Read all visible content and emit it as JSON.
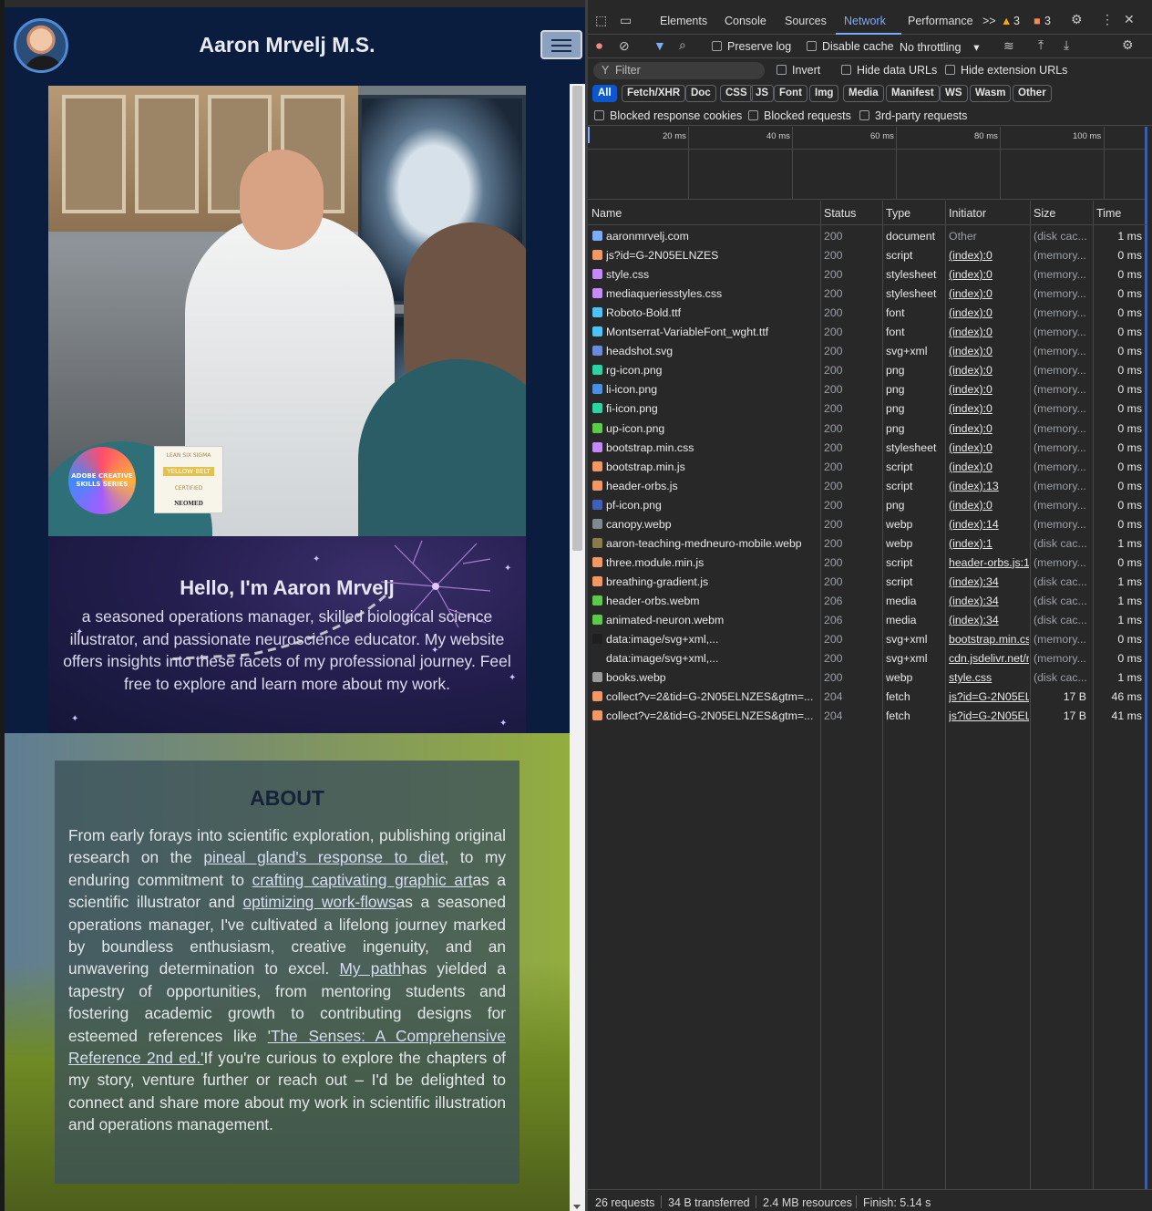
{
  "site": {
    "name": "Aaron Mrvelj M.S.",
    "badges": {
      "adobe": "ADOBE CREATIVE SKILLS SERIES",
      "yellow_belt_top": "LEAN SIX SIGMA",
      "yellow_belt": "YELLOW BELT",
      "yellow_belt_cert": "CERTIFIED",
      "neomed": "NEOMED"
    },
    "intro": {
      "title": "Hello, I'm Aaron Mrvelj",
      "body": "a seasoned operations manager, skilled biological science illustrator, and passionate neuroscience educator. My website offers insights into these facets of my professional journey. Feel free to explore and learn more about my work."
    },
    "about": {
      "title": "ABOUT",
      "p1": "From early forays into scientific exploration, publishing original research on the ",
      "link1": "pineal gland's response to diet",
      "p2": ", to my enduring commitment to ",
      "link2": "crafting captivating graphic art",
      "p3": "as a scientific illustrator and ",
      "link3": "optimizing work-flows",
      "p4": "as a seasoned operations manager, I've cultivated a lifelong journey marked by boundless enthusiasm, creative ingenuity, and an unwavering determination to excel. ",
      "link4": "My path",
      "p5": "has yielded a tapestry of opportunities, from mentoring students and fostering academic growth to contributing designs for esteemed references like ",
      "link5": "'The Senses: A Comprehensive Reference 2nd ed.'",
      "p6": "If you're curious to explore the chapters of my story, venture further or reach out – I'd be delighted to connect and share more about my work in scientific illustration and operations management."
    }
  },
  "devtools": {
    "tabs": [
      "Elements",
      "Console",
      "Sources",
      "Network",
      "Performance"
    ],
    "active_tab": "Network",
    "more_tabs": ">>",
    "warnings": "3",
    "errors": "3",
    "toolbar": {
      "preserve_log": "Preserve log",
      "disable_cache": "Disable cache",
      "throttling": "No throttling"
    },
    "filter": {
      "placeholder": "Filter",
      "invert": "Invert",
      "hide_data_urls": "Hide data URLs",
      "hide_ext_urls": "Hide extension URLs"
    },
    "type_filters": [
      "All",
      "Fetch/XHR",
      "Doc",
      "CSS",
      "JS",
      "Font",
      "Img",
      "Media",
      "Manifest",
      "WS",
      "Wasm",
      "Other"
    ],
    "options": {
      "blocked_cookies": "Blocked response cookies",
      "blocked_requests": "Blocked requests",
      "third_party": "3rd-party requests"
    },
    "timeline_labels": [
      "20 ms",
      "40 ms",
      "60 ms",
      "80 ms",
      "100 ms"
    ],
    "columns": [
      "Name",
      "Status",
      "Type",
      "Initiator",
      "Size",
      "Time"
    ],
    "requests": [
      {
        "name": "aaronmrvelj.com",
        "status": "200",
        "type": "document",
        "initiator": "Other",
        "size": "(disk cac...",
        "time": "1 ms",
        "icon": "doc-icon",
        "color": "#7cacf8"
      },
      {
        "name": "js?id=G-2N05ELNZES",
        "status": "200",
        "type": "script",
        "initiator": "(index):0",
        "size": "(memory...",
        "time": "0 ms",
        "icon": "script-icon",
        "color": "#f29766"
      },
      {
        "name": "style.css",
        "status": "200",
        "type": "stylesheet",
        "initiator": "(index):0",
        "size": "(memory...",
        "time": "0 ms",
        "icon": "css-icon",
        "color": "#c58af9"
      },
      {
        "name": "mediaqueriesstyles.css",
        "status": "200",
        "type": "stylesheet",
        "initiator": "(index):0",
        "size": "(memory...",
        "time": "0 ms",
        "icon": "css-icon",
        "color": "#c58af9"
      },
      {
        "name": "Roboto-Bold.ttf",
        "status": "200",
        "type": "font",
        "initiator": "(index):0",
        "size": "(memory...",
        "time": "0 ms",
        "icon": "font-icon",
        "color": "#4fc3f7"
      },
      {
        "name": "Montserrat-VariableFont_wght.ttf",
        "status": "200",
        "type": "font",
        "initiator": "(index):0",
        "size": "(memory...",
        "time": "0 ms",
        "icon": "font-icon",
        "color": "#4fc3f7"
      },
      {
        "name": "headshot.svg",
        "status": "200",
        "type": "svg+xml",
        "initiator": "(index):0",
        "size": "(memory...",
        "time": "0 ms",
        "icon": "image-icon",
        "color": "#6a8bd8"
      },
      {
        "name": "rg-icon.png",
        "status": "200",
        "type": "png",
        "initiator": "(index):0",
        "size": "(memory...",
        "time": "0 ms",
        "icon": "png-icon",
        "color": "#2bd4a2"
      },
      {
        "name": "li-icon.png",
        "status": "200",
        "type": "png",
        "initiator": "(index):0",
        "size": "(memory...",
        "time": "0 ms",
        "icon": "png-icon",
        "color": "#4a90e2"
      },
      {
        "name": "fi-icon.png",
        "status": "200",
        "type": "png",
        "initiator": "(index):0",
        "size": "(memory...",
        "time": "0 ms",
        "icon": "png-icon",
        "color": "#2bd4a2"
      },
      {
        "name": "up-icon.png",
        "status": "200",
        "type": "png",
        "initiator": "(index):0",
        "size": "(memory...",
        "time": "0 ms",
        "icon": "png-icon",
        "color": "#5cc94a"
      },
      {
        "name": "bootstrap.min.css",
        "status": "200",
        "type": "stylesheet",
        "initiator": "(index):0",
        "size": "(memory...",
        "time": "0 ms",
        "icon": "css-icon",
        "color": "#c58af9"
      },
      {
        "name": "bootstrap.min.js",
        "status": "200",
        "type": "script",
        "initiator": "(index):0",
        "size": "(memory...",
        "time": "0 ms",
        "icon": "script-icon",
        "color": "#f29766"
      },
      {
        "name": "header-orbs.js",
        "status": "200",
        "type": "script",
        "initiator": "(index):13",
        "size": "(memory...",
        "time": "0 ms",
        "icon": "script-icon",
        "color": "#f29766"
      },
      {
        "name": "pf-icon.png",
        "status": "200",
        "type": "png",
        "initiator": "(index):0",
        "size": "(memory...",
        "time": "0 ms",
        "icon": "png-icon",
        "color": "#3f5fb8"
      },
      {
        "name": "canopy.webp",
        "status": "200",
        "type": "webp",
        "initiator": "(index):14",
        "size": "(memory...",
        "time": "0 ms",
        "icon": "webp-icon",
        "color": "#7d8a8f"
      },
      {
        "name": "aaron-teaching-medneuro-mobile.webp",
        "status": "200",
        "type": "webp",
        "initiator": "(index):1",
        "size": "(disk cac...",
        "time": "1 ms",
        "icon": "webp-icon",
        "color": "#8a7a4f"
      },
      {
        "name": "three.module.min.js",
        "status": "200",
        "type": "script",
        "initiator": "header-orbs.js:1",
        "size": "(memory...",
        "time": "0 ms",
        "icon": "script-icon",
        "color": "#f29766"
      },
      {
        "name": "breathing-gradient.js",
        "status": "200",
        "type": "script",
        "initiator": "(index):34",
        "size": "(disk cac...",
        "time": "1 ms",
        "icon": "script-icon",
        "color": "#f29766"
      },
      {
        "name": "header-orbs.webm",
        "status": "206",
        "type": "media",
        "initiator": "(index):34",
        "size": "(disk cac...",
        "time": "1 ms",
        "icon": "media-icon",
        "color": "#5cc94a"
      },
      {
        "name": "animated-neuron.webm",
        "status": "206",
        "type": "media",
        "initiator": "(index):34",
        "size": "(disk cac...",
        "time": "1 ms",
        "icon": "media-icon",
        "color": "#5cc94a"
      },
      {
        "name": "data:image/svg+xml,...",
        "status": "200",
        "type": "svg+xml",
        "initiator": "bootstrap.min.cs",
        "size": "(memory...",
        "time": "0 ms",
        "icon": "close-x-icon",
        "color": "#1f1f1f"
      },
      {
        "name": "data:image/svg+xml,...",
        "status": "200",
        "type": "svg+xml",
        "initiator": "cdn.jsdelivr.net/r",
        "size": "(memory...",
        "time": "0 ms",
        "icon": "blank-icon",
        "color": "#282828"
      },
      {
        "name": "books.webp",
        "status": "200",
        "type": "webp",
        "initiator": "style.css",
        "size": "(disk cac...",
        "time": "1 ms",
        "icon": "webp-icon",
        "color": "#9a9a9a"
      },
      {
        "name": "collect?v=2&tid=G-2N05ELNZES&gtm=...",
        "status": "204",
        "type": "fetch",
        "initiator": "js?id=G-2N05ELI",
        "size": "17 B",
        "time": "46 ms",
        "icon": "fetch-icon",
        "color": "#f29766"
      },
      {
        "name": "collect?v=2&tid=G-2N05ELNZES&gtm=...",
        "status": "204",
        "type": "fetch",
        "initiator": "js?id=G-2N05ELI",
        "size": "17 B",
        "time": "41 ms",
        "icon": "fetch-icon",
        "color": "#f29766"
      }
    ],
    "status_bar": {
      "requests": "26 requests",
      "transferred": "34 B transferred",
      "resources": "2.4 MB resources",
      "finish": "Finish: 5.14 s"
    }
  }
}
